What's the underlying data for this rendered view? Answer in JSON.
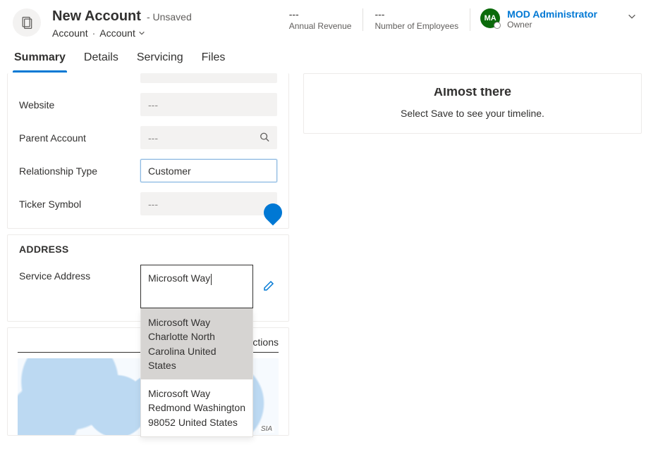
{
  "header": {
    "title": "New Account",
    "status": "- Unsaved",
    "entity": "Account",
    "entity_dropdown_label": "Account",
    "fields": {
      "annual_revenue": {
        "value": "---",
        "label": "Annual Revenue"
      },
      "employees": {
        "value": "---",
        "label": "Number of Employees"
      }
    },
    "owner": {
      "initials": "MA",
      "name": "MOD Administrator",
      "label": "Owner"
    }
  },
  "tabs": [
    {
      "label": "Summary",
      "active": true
    },
    {
      "label": "Details",
      "active": false
    },
    {
      "label": "Servicing",
      "active": false
    },
    {
      "label": "Files",
      "active": false
    }
  ],
  "fields": {
    "website": {
      "label": "Website",
      "value": "---"
    },
    "parent_account": {
      "label": "Parent Account",
      "value": "---"
    },
    "relationship_type": {
      "label": "Relationship Type",
      "value": "Customer"
    },
    "ticker_symbol": {
      "label": "Ticker Symbol",
      "value": "---"
    }
  },
  "address_section": {
    "title": "ADDRESS",
    "service_address_label": "Service Address",
    "input_value": "Microsoft Way",
    "suggestions": [
      "Microsoft Way Charlotte North Carolina United States",
      "Microsoft Way Redmond Washington 98052 United States"
    ]
  },
  "map_section": {
    "directions_label": "ctions",
    "attribution": "SIA"
  },
  "timeline": {
    "title": "Almost there",
    "message": "Select Save to see your timeline."
  }
}
